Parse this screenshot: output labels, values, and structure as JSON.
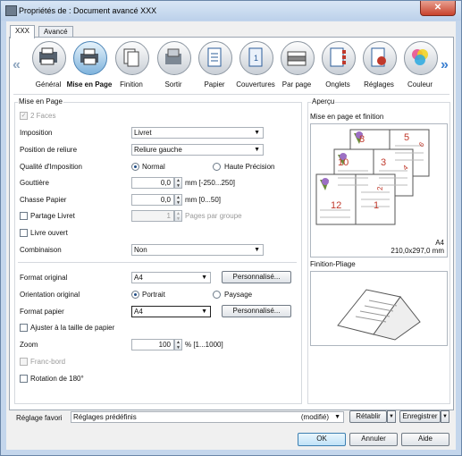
{
  "window": {
    "title": "Propriétés de : Document avancé XXX",
    "close": "✕"
  },
  "tabs": [
    "XXX",
    "Avancé"
  ],
  "iconbar": {
    "left_arrow": "«",
    "right_arrow": "»",
    "items": [
      {
        "label": "Général",
        "icon": "general-icon"
      },
      {
        "label": "Mise en Page",
        "icon": "layout-icon"
      },
      {
        "label": "Finition",
        "icon": "finishing-icon"
      },
      {
        "label": "Sortir",
        "icon": "output-icon"
      },
      {
        "label": "Papier",
        "icon": "paper-icon"
      },
      {
        "label": "Couvertures",
        "icon": "cover-icon"
      },
      {
        "label": "Par page",
        "icon": "per-page-icon"
      },
      {
        "label": "Onglets",
        "icon": "tabs-icon"
      },
      {
        "label": "Réglages",
        "icon": "settings-icon"
      },
      {
        "label": "Couleur",
        "icon": "color-icon"
      }
    ]
  },
  "layout": {
    "group_label": "Mise en Page",
    "two_sides": "2 Faces",
    "imposition_label": "Imposition",
    "imposition_value": "Livret",
    "binding_label": "Position de reliure",
    "binding_value": "Reliure gauche",
    "quality_label": "Qualité d'Imposition",
    "quality_normal": "Normal",
    "quality_high": "Haute Précision",
    "gutter_label": "Gouttière",
    "gutter_value": "0,0",
    "gutter_unit": "mm [-250...250]",
    "creep_label": "Chasse Papier",
    "creep_value": "0,0",
    "creep_unit": "mm [0...50]",
    "split_label": "Partage Livret",
    "split_value": "1",
    "split_unit": "Pages par groupe",
    "open_book_label": "Livre ouvert",
    "combination_label": "Combinaison",
    "combination_value": "Non",
    "orig_size_label": "Format original",
    "orig_size_value": "A4",
    "custom_button": "Personnalisé...",
    "orig_orientation_label": "Orientation original",
    "portrait": "Portrait",
    "landscape": "Paysage",
    "paper_size_label": "Format papier",
    "paper_size_value": "A4",
    "fit_paper_label": "Ajuster à la taille de papier",
    "zoom_label": "Zoom",
    "zoom_value": "100",
    "zoom_unit": "% [1...1000]",
    "bleed_label": "Franc-bord",
    "rotate_label": "Rotation de 180°"
  },
  "preview": {
    "group_label": "Aperçu",
    "layout_label": "Mise en page et finition",
    "page_numbers": [
      "8",
      "5",
      "6",
      "10",
      "3",
      "4",
      "12",
      "1",
      "2"
    ],
    "size_label": "A4",
    "dims": "210,0x297,0 mm",
    "fold_label": "Finition-Pliage"
  },
  "favorites": {
    "label": "Réglage favori",
    "value": "Réglages prédéfinis",
    "modified": "(modifié)",
    "restore": "Rétablir",
    "save": "Enregistrer"
  },
  "footer": {
    "ok": "OK",
    "cancel": "Annuler",
    "help": "Aide"
  }
}
